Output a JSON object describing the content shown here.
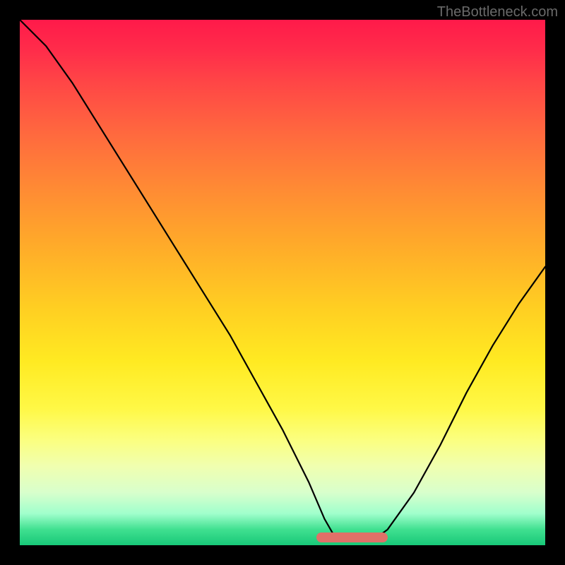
{
  "watermark": "TheBottleneck.com",
  "chart_data": {
    "type": "line",
    "title": "",
    "xlabel": "",
    "ylabel": "",
    "xlim": [
      0,
      1
    ],
    "ylim": [
      0,
      1
    ],
    "series": [
      {
        "name": "bottleneck-curve",
        "x": [
          0.0,
          0.05,
          0.1,
          0.15,
          0.2,
          0.25,
          0.3,
          0.35,
          0.4,
          0.45,
          0.5,
          0.55,
          0.58,
          0.6,
          0.62,
          0.65,
          0.68,
          0.7,
          0.75,
          0.8,
          0.85,
          0.9,
          0.95,
          1.0
        ],
        "y": [
          1.0,
          0.95,
          0.88,
          0.8,
          0.72,
          0.64,
          0.56,
          0.48,
          0.4,
          0.31,
          0.22,
          0.12,
          0.05,
          0.015,
          0.01,
          0.01,
          0.015,
          0.03,
          0.1,
          0.19,
          0.29,
          0.38,
          0.46,
          0.53
        ]
      }
    ],
    "optimal_band": {
      "x_start": 0.565,
      "x_end": 0.7,
      "y": 0.01
    },
    "background_gradient": {
      "stops": [
        {
          "pos": 0.0,
          "color": "#ff1a4a"
        },
        {
          "pos": 0.5,
          "color": "#ffd522"
        },
        {
          "pos": 0.8,
          "color": "#fbff80"
        },
        {
          "pos": 1.0,
          "color": "#18c878"
        }
      ]
    }
  }
}
